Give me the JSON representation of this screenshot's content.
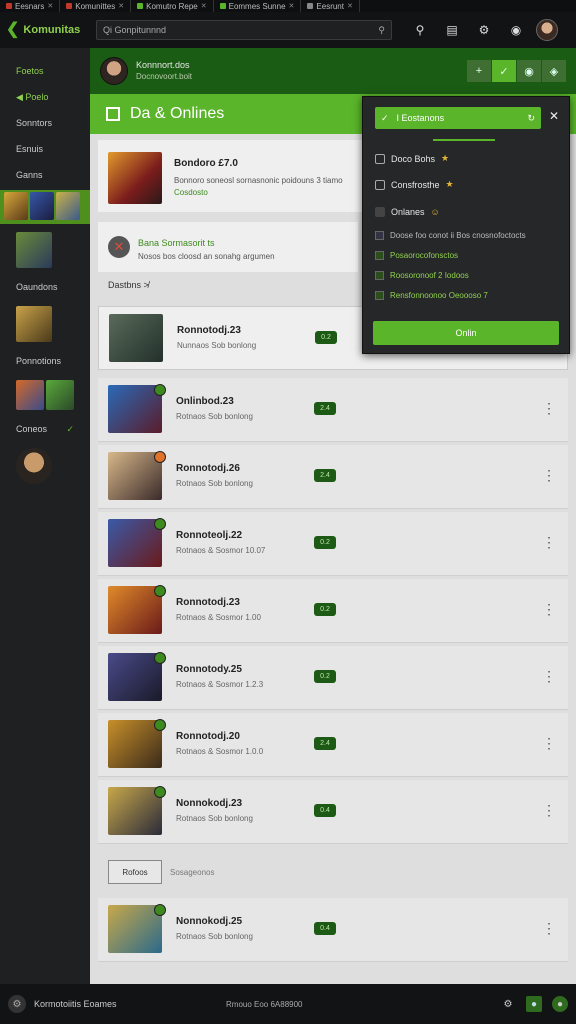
{
  "browser_tabs": [
    {
      "label": "Eesnars",
      "color": "#c0392b"
    },
    {
      "label": "Komunittes",
      "color": "#c0392b"
    },
    {
      "label": "Komutro Repe",
      "color": "#5ab52a"
    },
    {
      "label": "Eommes Sunne",
      "color": "#5ab52a"
    },
    {
      "label": "Eesrunt",
      "color": "#888888"
    }
  ],
  "app": {
    "name": "Komunitas",
    "search_placeholder": "Qi Gonpitunnnd"
  },
  "sidebar": {
    "items": [
      "Foetos",
      "Poelo",
      "Sonntors",
      "Esnuis",
      "Ganns",
      "Oaundons",
      "Ponnotions",
      "Coneos"
    ]
  },
  "userbar": {
    "name": "Konnnort.dos",
    "sub": "Docnovoort.boit"
  },
  "headline": "Da & Onlines",
  "featured": {
    "title": "Bondoro £7.0",
    "desc": "Bonnoro soneosl sornasnonic poidouns 3 tiamo",
    "sub": "Cosdosto"
  },
  "alert": {
    "title": "Bana Sormasorit ts",
    "desc": "Nosos bos cloosd an sonahg argumen"
  },
  "section_label": "Dastbns ≯",
  "rows": [
    {
      "title": "Ronnotodj.23",
      "desc": "Nunnaos Sob bonlong",
      "tag": "0.2"
    },
    {
      "title": "Onlinbod.23",
      "desc": "Rotnaos Sob bonlong",
      "tag": "2.4"
    },
    {
      "title": "Ronnotodj.26",
      "desc": "Rotnaos Sob bonlong",
      "tag": "2.4"
    },
    {
      "title": "Ronnoteolj.22",
      "desc": "Rotnaos & Sosmor 10.07",
      "tag": "0.2"
    },
    {
      "title": "Ronnotodj.23",
      "desc": "Rotnaos & Sosmor 1.00",
      "tag": "0.2"
    },
    {
      "title": "Ronnotody.25",
      "desc": "Rotnaos & Sosmor 1.2.3",
      "tag": "0.2"
    },
    {
      "title": "Ronnotodj.20",
      "desc": "Rotnaos & Sosmor 1.0.0",
      "tag": "2.4"
    },
    {
      "title": "Nonnokodj.23",
      "desc": "Rotnaos Sob bonlong",
      "tag": "0.4"
    },
    {
      "title": "Nonnokodj.25",
      "desc": "Rotnaos Sob bonlong",
      "tag": "0.4"
    }
  ],
  "pager": {
    "button": "Rofoos",
    "text": "Sosageonos"
  },
  "panel": {
    "header": "I Eostanons",
    "options": [
      "Doco Bohs",
      "Consfrosthe",
      "Onlanes"
    ],
    "subs": [
      {
        "label": "Doose foo conot ii Bos cnosnofoctocts",
        "green": false
      },
      {
        "label": "Posaorocofonsctos",
        "green": true
      },
      {
        "label": "Roosoronoof 2 Iodoos",
        "green": true
      },
      {
        "label": "Rensfonnoonoo Oeoooso 7",
        "green": true
      }
    ],
    "button": "Onlin"
  },
  "footer": {
    "left": "Kormotoiitis Eoames",
    "center": "Rmouo Eoo 6A88900"
  },
  "colors": {
    "accent": "#5ab52a",
    "dark_green": "#1b5c14",
    "bg": "#1b1c1e"
  }
}
